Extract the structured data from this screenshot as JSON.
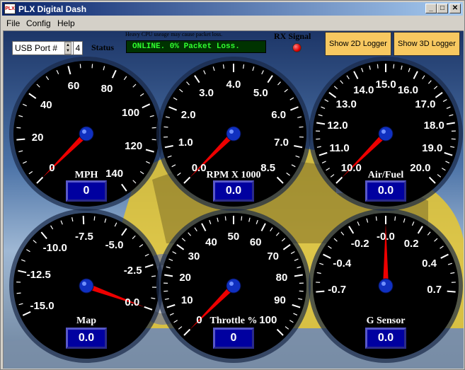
{
  "window": {
    "title": "PLX Digital Dash",
    "app_icon": "PLX"
  },
  "menu": [
    {
      "label": "File"
    },
    {
      "label": "Config"
    },
    {
      "label": "Help"
    }
  ],
  "toolbar": {
    "usb_label": "USB Port #",
    "usb_value": "4",
    "status_label": "Status",
    "warning": "Heavy CPU useage may cause packet loss.",
    "status_text": "ONLINE. 0% Packet Loss.",
    "rx_label": "RX Signal",
    "logger_2d": "Show 2D Logger",
    "logger_3d": "Show 3D Logger",
    "rx_color": "#e00000"
  },
  "gauges": [
    {
      "id": "mph",
      "label": "MPH",
      "value": "0.0",
      "display": "0",
      "ticks": [
        "0",
        "20",
        "40",
        "60",
        "80",
        "100",
        "120",
        "140"
      ]
    },
    {
      "id": "rpm",
      "label": "RPM X 1000",
      "value": "0.0",
      "display": "0.0",
      "ticks": [
        "0.0",
        "1.0",
        "2.0",
        "3.0",
        "4.0",
        "5.0",
        "6.0",
        "7.0",
        "8.5"
      ]
    },
    {
      "id": "airfuel",
      "label": "Air/Fuel",
      "value": "10.0",
      "display": "0.0",
      "ticks": [
        "10.0",
        "11.0",
        "12.0",
        "13.0",
        "14.0",
        "15.0",
        "16.0",
        "17.0",
        "18.0",
        "19.0",
        "20.0"
      ]
    },
    {
      "id": "map",
      "label": "Map",
      "value": "0.0",
      "display": "0.0",
      "ticks": [
        "-15.0",
        "-12.5",
        "-10.0",
        "-7.5",
        "-5.0",
        "-2.5",
        "0.0"
      ]
    },
    {
      "id": "throttle",
      "label": "Throttle %",
      "value": "0",
      "display": "0",
      "ticks": [
        "0",
        "10",
        "20",
        "30",
        "40",
        "50",
        "60",
        "70",
        "80",
        "90",
        "100"
      ]
    },
    {
      "id": "gsensor",
      "label": "G Sensor",
      "value": "0.0",
      "display": "0.0",
      "ticks": [
        "-0.7",
        "-0.4",
        "-0.2",
        "-0.0",
        "0.2",
        "0.4",
        "0.7"
      ]
    }
  ]
}
